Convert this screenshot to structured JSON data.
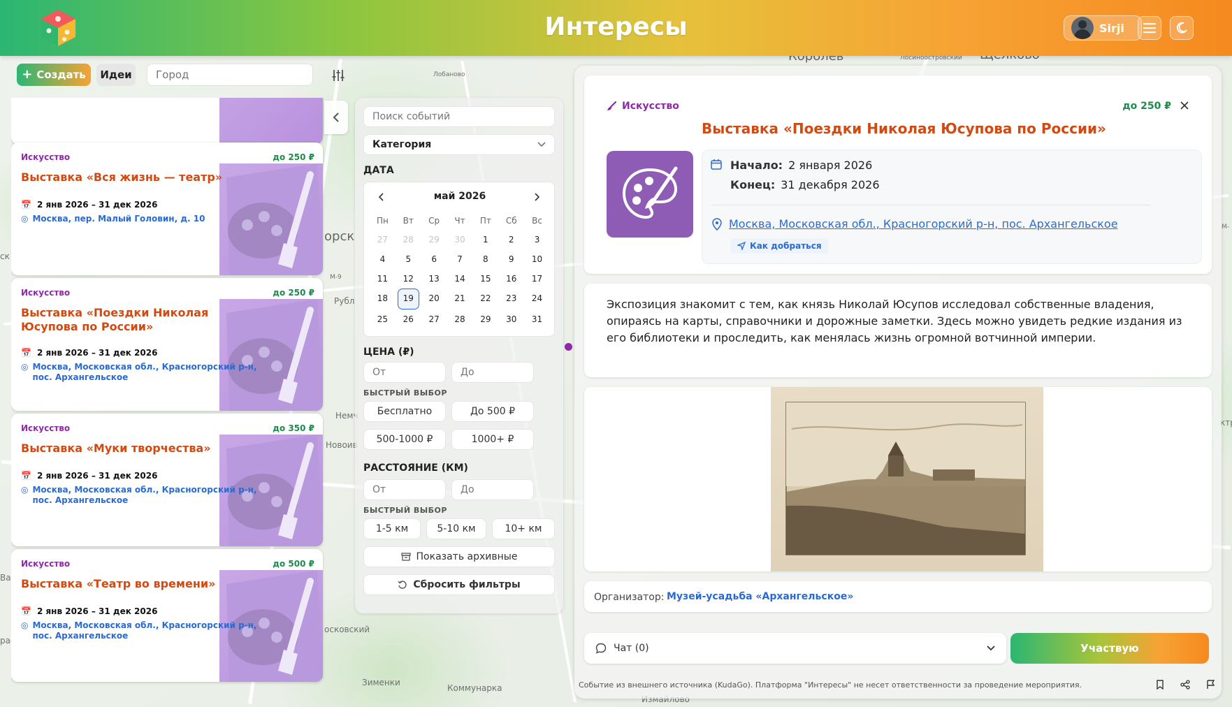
{
  "header": {
    "title": "Интересы",
    "user_name": "Sirji"
  },
  "toolbar": {
    "create_label": "Создать",
    "ideas_label": "Идеи",
    "city_placeholder": "Город"
  },
  "map": {
    "labels": [
      "Королев",
      "Щелково",
      "Лобаново",
      "орск",
      "М-9",
      "Рубл",
      "Немч",
      "Новоив",
      "осковский",
      "Зименки",
      "Коммунарка",
      "Измайлово",
      "Лосиноостровский",
      "ск",
      "М-",
      "ктр",
      "Ва",
      "рас"
    ]
  },
  "cards": [
    {
      "category": "Искусство",
      "price": "до 250 ₽",
      "title": "Выставка «Вся жизнь — театр»",
      "dates": "2 янв 2026 – 31 дек 2026",
      "address": "Москва, пер. Малый Головин, д. 10"
    },
    {
      "category": "Искусство",
      "price": "до 250 ₽",
      "title": "Выставка «Поездки Николая Юсупова по России»",
      "dates": "2 янв 2026 – 31 дек 2026",
      "address": "Москва, Московская обл., Красногорский р-н, пос. Архангельское"
    },
    {
      "category": "Искусство",
      "price": "до 350 ₽",
      "title": "Выставка «Муки творчества»",
      "dates": "2 янв 2026 – 31 дек 2026",
      "address": "Москва, Московская обл., Красногорский р-н, пос. Архангельское"
    },
    {
      "category": "Искусство",
      "price": "до 500 ₽",
      "title": "Выставка «Театр во времени»",
      "dates": "2 янв 2026 – 31 дек 2026",
      "address": "Москва, Московская обл., Красногорский р-н, пос. Архангельское"
    }
  ],
  "filters": {
    "search_placeholder": "Поиск событий",
    "category_label": "Категория",
    "date_heading": "ДАТА",
    "calendar": {
      "month": "май 2026",
      "weekdays": [
        "Пн",
        "Вт",
        "Ср",
        "Чт",
        "Пт",
        "Сб",
        "Вс"
      ],
      "leading_days": [
        "27",
        "28",
        "29",
        "30"
      ],
      "days_in_month": 31,
      "selected_day": "19"
    },
    "price_heading": "ЦЕНА (₽)",
    "from_placeholder": "От",
    "to_placeholder": "До",
    "quick_heading": "БЫСТРЫЙ ВЫБОР",
    "price_chips": [
      "Бесплатно",
      "До 500 ₽",
      "500-1000 ₽",
      "1000+ ₽"
    ],
    "distance_heading": "РАССТОЯНИЕ (КМ)",
    "distance_chips": [
      "1-5 км",
      "5-10 км",
      "10+ км"
    ],
    "archive_label": "Показать архивные",
    "reset_label": "Сбросить фильтры"
  },
  "detail": {
    "category": "Искусство",
    "price": "до 250 ₽",
    "title": "Выставка «Поездки Николая Юсупова по России»",
    "start_label": "Начало:",
    "start_value": "2 января 2026",
    "end_label": "Конец:",
    "end_value": "31 декабря 2026",
    "address": "Москва, Московская обл., Красногорский р-н, пос. Архангельское",
    "route_label": "Как добраться",
    "description": "Экспозиция знакомит с тем, как князь Николай Юсупов исследовал собственные владения, опираясь на карты, справочники и дорожные заметки. Здесь можно увидеть редкие издания из его библиотеки и проследить, как менялась жизнь огромной вотчинной империи.",
    "organizer_label": "Организатор:",
    "organizer_name": "Музей-усадьба «Архангельское»",
    "chat_label": "Чат (0)",
    "join_label": "Участвую",
    "disclaimer": "Событие из внешнего источника (KudaGo). Платформа \"Интересы\" не несет ответственности за проведение мероприятия."
  },
  "colors": {
    "accent_green": "#2bb673",
    "accent_orange": "#f58a1f",
    "title_red": "#d04a14",
    "category_purple": "#8e2aa8",
    "link_blue": "#2a6bd1",
    "price_green": "#1f8a4c"
  },
  "icons": [
    "logo-cube-icon",
    "menu-icon",
    "moon-icon",
    "plus-icon",
    "sliders-icon",
    "chevron-left-icon",
    "calendar-icon",
    "location-pin-icon",
    "brush-icon",
    "close-icon",
    "navigation-icon",
    "chat-icon",
    "chevron-down-icon",
    "archive-icon",
    "reset-icon",
    "bookmark-icon",
    "share-icon",
    "flag-icon"
  ]
}
